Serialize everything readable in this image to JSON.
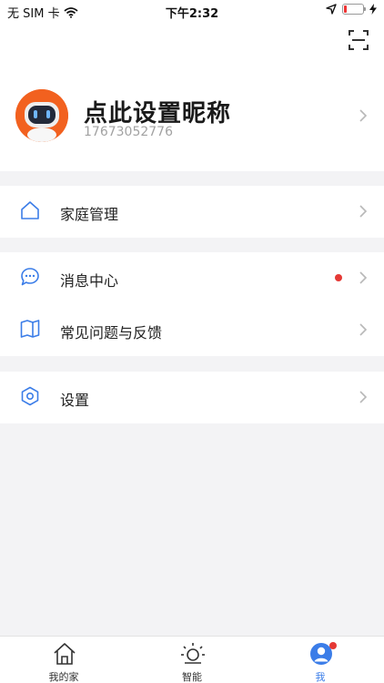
{
  "status_bar": {
    "carrier": "无 SIM 卡",
    "time": "下午2:32"
  },
  "profile": {
    "name": "点此设置昵称",
    "phone": "17673052776"
  },
  "menu": {
    "home_management": "家庭管理",
    "message_center": "消息中心",
    "faq_feedback": "常见问题与反馈",
    "settings": "设置"
  },
  "tabbar": {
    "home": "我的家",
    "smart": "智能",
    "me": "我"
  },
  "colors": {
    "accent": "#3b7de8",
    "badge": "#e53935",
    "avatar_bg": "#f2611f"
  }
}
